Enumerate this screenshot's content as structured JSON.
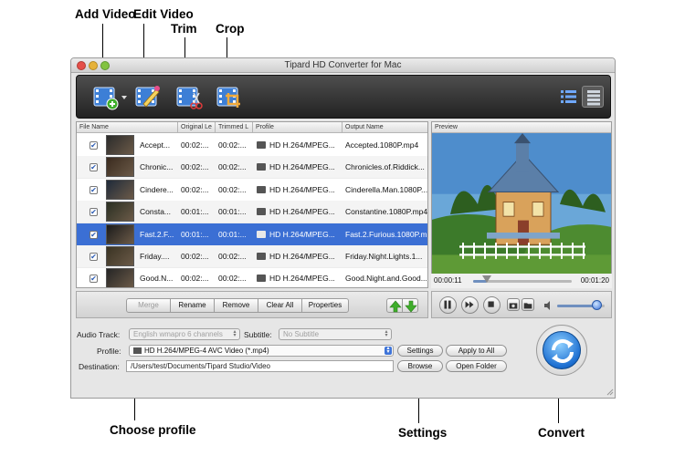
{
  "callouts": {
    "add_video": "Add Video",
    "edit_video": "Edit Video",
    "trim": "Trim",
    "crop": "Crop",
    "choose_profile": "Choose profile",
    "settings": "Settings",
    "convert": "Convert"
  },
  "window": {
    "title": "Tipard HD Converter for Mac"
  },
  "columns": {
    "file_name": "File Name",
    "original_length": "Original Le",
    "trimmed_length": "Trimmed L",
    "profile": "Profile",
    "output_name": "Output Name",
    "preview": "Preview"
  },
  "files": [
    {
      "name": "Accept...",
      "original": "00:02:...",
      "trimmed": "00:02:...",
      "profile": "HD H.264/MPEG...",
      "output": "Accepted.1080P.mp4",
      "checked": true,
      "selected": false
    },
    {
      "name": "Chronic...",
      "original": "00:02:...",
      "trimmed": "00:02:...",
      "profile": "HD H.264/MPEG...",
      "output": "Chronicles.of.Riddick...",
      "checked": true,
      "selected": false
    },
    {
      "name": "Cindere...",
      "original": "00:02:...",
      "trimmed": "00:02:...",
      "profile": "HD H.264/MPEG...",
      "output": "Cinderella.Man.1080P...",
      "checked": true,
      "selected": false
    },
    {
      "name": "Consta...",
      "original": "00:01:...",
      "trimmed": "00:01:...",
      "profile": "HD H.264/MPEG...",
      "output": "Constantine.1080P.mp4",
      "checked": true,
      "selected": false
    },
    {
      "name": "Fast.2.F...",
      "original": "00:01:...",
      "trimmed": "00:01:...",
      "profile": "HD H.264/MPEG...",
      "output": "Fast.2.Furious.1080P.mp4",
      "checked": true,
      "selected": true
    },
    {
      "name": "Friday....",
      "original": "00:02:...",
      "trimmed": "00:02:...",
      "profile": "HD H.264/MPEG...",
      "output": "Friday.Night.Lights.1...",
      "checked": true,
      "selected": false
    },
    {
      "name": "Good.N...",
      "original": "00:02:...",
      "trimmed": "00:02:...",
      "profile": "HD H.264/MPEG...",
      "output": "Good.Night.and.Good...",
      "checked": true,
      "selected": false
    }
  ],
  "actions": {
    "merge": "Merge",
    "rename": "Rename",
    "remove": "Remove",
    "clear_all": "Clear All",
    "properties": "Properties"
  },
  "player": {
    "current_time": "00:00:11",
    "total_time": "00:01:20",
    "progress": 0.14,
    "volume": 0.85
  },
  "settings": {
    "audio_track_label": "Audio Track:",
    "audio_track_value": "English wmapro 6 channels",
    "subtitle_label": "Subtitle:",
    "subtitle_value": "No Subtitle",
    "profile_label": "Profile:",
    "profile_value": "HD H.264/MPEG-4 AVC Video (*.mp4)",
    "destination_label": "Destination:",
    "destination_value": "/Users/test/Documents/Tipard Studio/Video",
    "settings_button": "Settings",
    "apply_to_all_button": "Apply to All",
    "browse_button": "Browse",
    "open_folder_button": "Open Folder"
  },
  "colors": {
    "selection": "#3b6fd4",
    "toolbar": "#2e2e2e",
    "convert_accent": "#1d6fd1",
    "arrow_green": "#3fae2b"
  },
  "icons": {
    "add_video": "film-add-icon",
    "edit_video": "film-edit-icon",
    "trim": "film-trim-icon",
    "crop": "film-crop-icon",
    "list_view": "list-view-icon",
    "detail_view": "detail-view-icon",
    "convert": "refresh-arrows-icon"
  }
}
